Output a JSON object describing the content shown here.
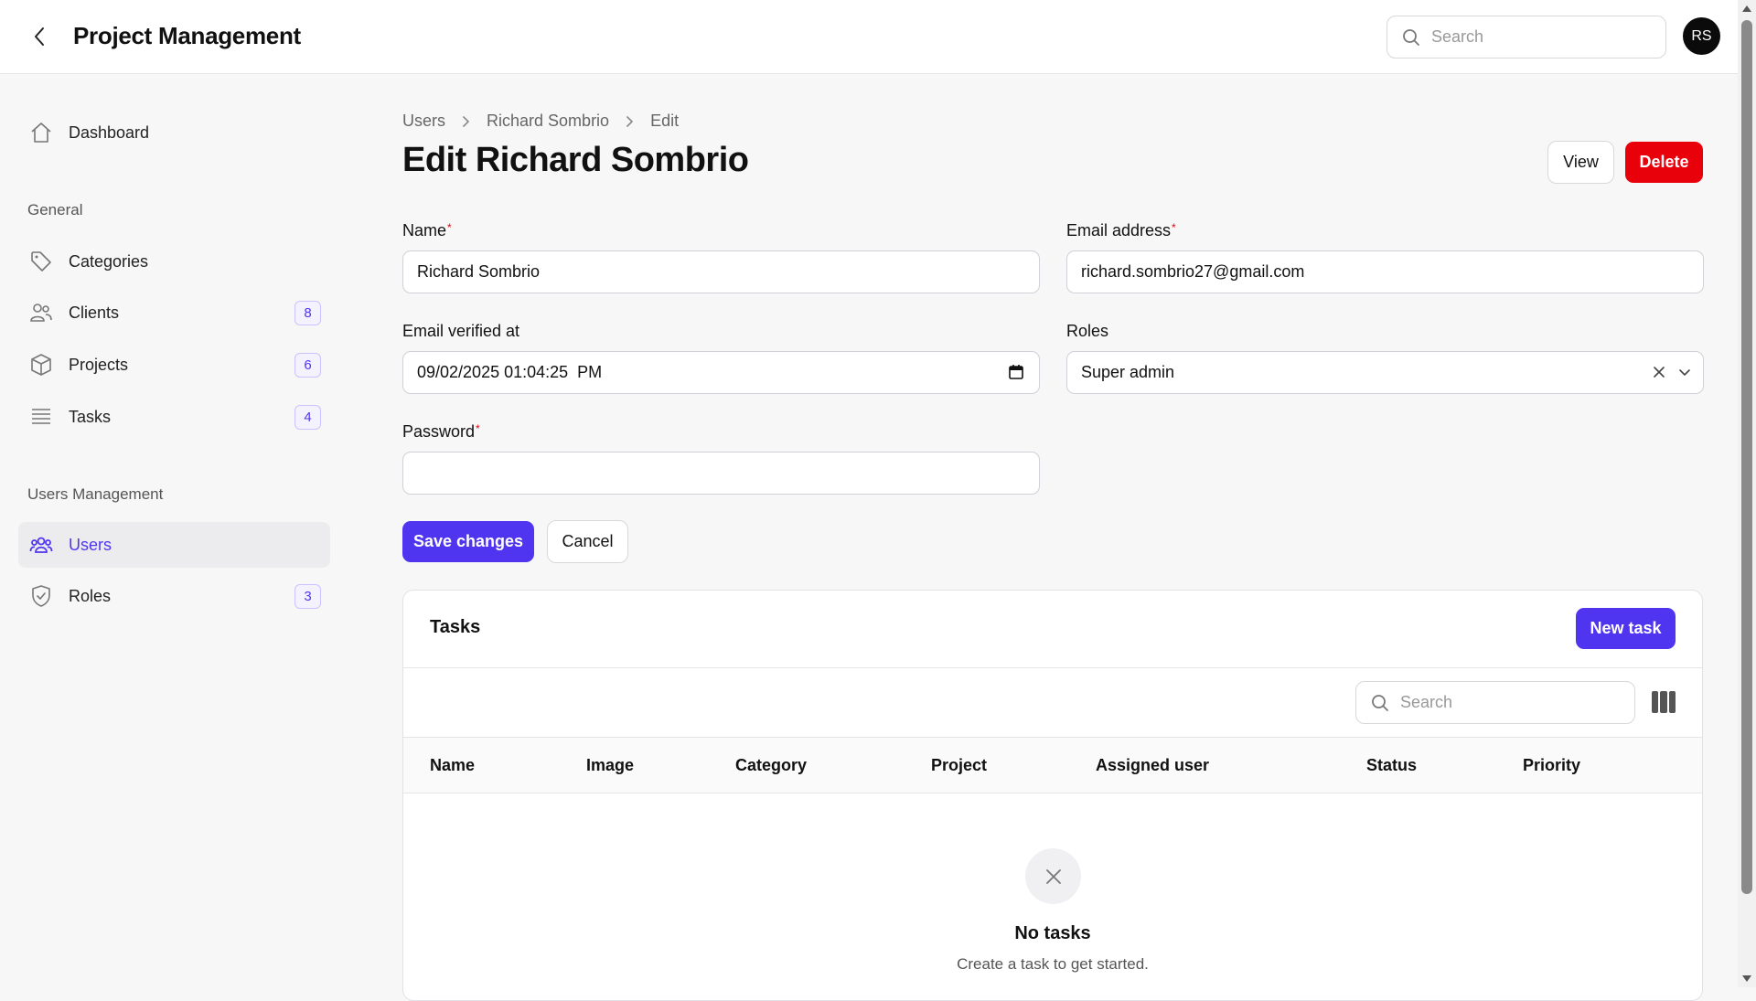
{
  "header": {
    "title": "Project Management",
    "search_placeholder": "Search",
    "avatar_initials": "RS"
  },
  "sidebar": {
    "dashboard": "Dashboard",
    "groups": [
      {
        "label": "General",
        "items": [
          {
            "label": "Categories",
            "icon": "tag-icon"
          },
          {
            "label": "Clients",
            "icon": "users-icon",
            "count": "8"
          },
          {
            "label": "Projects",
            "icon": "cube-icon",
            "count": "6"
          },
          {
            "label": "Tasks",
            "icon": "list-icon",
            "count": "4"
          }
        ]
      },
      {
        "label": "Users Management",
        "items": [
          {
            "label": "Users",
            "icon": "user-group-icon",
            "active": true
          },
          {
            "label": "Roles",
            "icon": "shield-icon",
            "count": "3"
          }
        ]
      }
    ]
  },
  "breadcrumb": [
    "Users",
    "Richard Sombrio",
    "Edit"
  ],
  "page": {
    "title": "Edit Richard Sombrio",
    "view_label": "View",
    "delete_label": "Delete"
  },
  "form": {
    "name_label": "Name",
    "name_value": "Richard Sombrio",
    "email_label": "Email address",
    "email_value": "richard.sombrio27@gmail.com",
    "verified_label": "Email verified at",
    "verified_value": "09/02/2025 01:04:25  PM",
    "roles_label": "Roles",
    "roles_value": "Super admin",
    "password_label": "Password",
    "password_value": "",
    "required_mark": "*",
    "save_label": "Save changes",
    "cancel_label": "Cancel"
  },
  "tasks": {
    "title": "Tasks",
    "new_label": "New task",
    "search_placeholder": "Search",
    "columns": [
      "Name",
      "Image",
      "Category",
      "Project",
      "Assigned user",
      "Status",
      "Priority"
    ],
    "empty_title": "No tasks",
    "empty_subtitle": "Create a task to get started."
  },
  "colors": {
    "accent": "#4f35f0",
    "danger": "#e8000b"
  }
}
